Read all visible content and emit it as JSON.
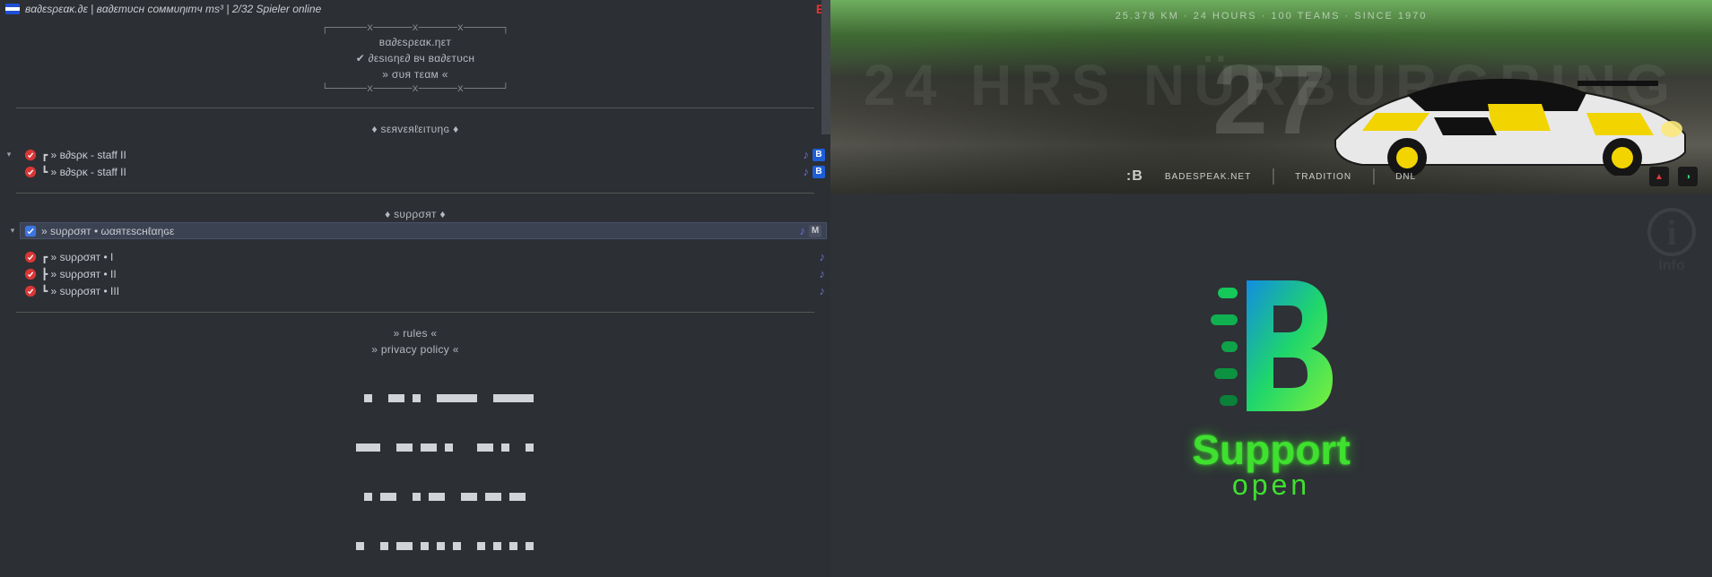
{
  "header": {
    "title": "вα∂εsρεακ.∂ε | вα∂εтυcн coммυηιтч тs³ | 2/32 Spieler online",
    "brand_icon_letter": "B"
  },
  "ascii_top": "┌──────x──────x──────x──────┐",
  "ascii_bot": "└──────x──────x──────x──────┘",
  "header_lines": {
    "line1": "вα∂εsρεακ.ηεт",
    "line2": "✔ ∂εsιɢηε∂ вч вα∂εтυcн",
    "line3": "» συя тεαм «"
  },
  "section_serverleitung": {
    "title": "♦ sεяvεяℓειтυηɢ ♦",
    "channels": [
      {
        "label": "┏ » в∂sρκ - staff II",
        "music": true,
        "b": true
      },
      {
        "label": "┗ » в∂sρκ - staff II",
        "music": true,
        "b": true
      }
    ]
  },
  "section_support": {
    "title": "♦ sυρρσят ♦",
    "queue": {
      "label": "» sυρρσят • ωαятεscнℓαηɢε",
      "music": true,
      "m": true
    },
    "channels": [
      {
        "label": "┏ » sυρρσят • I",
        "music": true
      },
      {
        "label": "┣ » sυρρσят • II",
        "music": true
      },
      {
        "label": "┗ » sυρρσят • III",
        "music": true
      }
    ]
  },
  "footer_links": {
    "rules": "» rules «",
    "privacy": "» privacy policy «"
  },
  "banner": {
    "topline": "25.378 KM · 24 HOURS · 100 TEAMS · SINCE 1970",
    "bigtext": "24 HRS NÜRBURGRING",
    "bignum": "27",
    "logos": {
      "brand": "BADESPEAK.NET",
      "l2": "TRADITION",
      "l3": "DNL"
    }
  },
  "info_watermark": {
    "icon": "i",
    "label": "Info"
  },
  "support_panel": {
    "title": "Support",
    "status": "open"
  }
}
